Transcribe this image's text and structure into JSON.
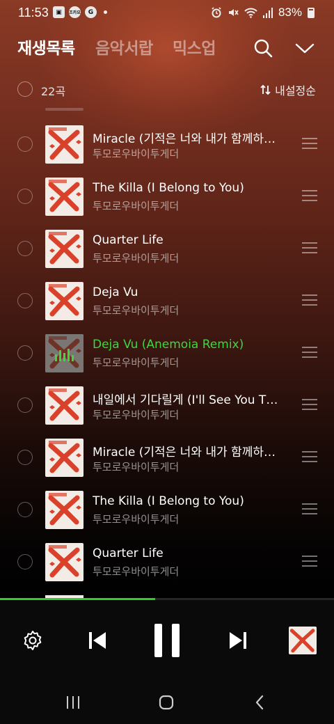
{
  "status_bar": {
    "time": "11:53",
    "left_icons": [
      "gallery-icon",
      "weather-badge-icon",
      "g-badge-icon",
      "dot"
    ],
    "weather_badge": "조카요",
    "g_badge": "G",
    "battery": "83%",
    "right_icons": [
      "alarm-icon",
      "mute-icon",
      "wifi-icon",
      "signal-icon",
      "battery-icon"
    ]
  },
  "header": {
    "tabs": [
      {
        "label": "재생목록",
        "active": true
      },
      {
        "label": "음악서랍",
        "active": false
      },
      {
        "label": "믹스업",
        "active": false
      }
    ]
  },
  "subbar": {
    "count": "22곡",
    "sort_label": "내설정순"
  },
  "playlist": {
    "items": [
      {
        "title": "Miracle (기적은 너와 내가 함께하는 순간마다 일어나고 있어)",
        "artist": "투모로우바이투게더",
        "playing": false
      },
      {
        "title": "The Killa (I Belong to You)",
        "artist": "투모로우바이투게더",
        "playing": false
      },
      {
        "title": "Quarter Life",
        "artist": "투모로우바이투게더",
        "playing": false
      },
      {
        "title": "Deja Vu",
        "artist": "투모로우바이투게더",
        "playing": false
      },
      {
        "title": "Deja Vu (Anemoia Remix)",
        "artist": "투모로우바이투게더",
        "playing": true
      },
      {
        "title": "내일에서 기다릴게 (I'll See You There Tomorrow)",
        "artist": "투모로우바이투게더",
        "playing": false
      },
      {
        "title": "Miracle (기적은 너와 내가 함께하는 순간마다 일어나고 있어)",
        "artist": "투모로우바이투게더",
        "playing": false
      },
      {
        "title": "The Killa (I Belong to You)",
        "artist": "투모로우바이투게더",
        "playing": false
      },
      {
        "title": "Quarter Life",
        "artist": "투모로우바이투게더",
        "playing": false
      }
    ]
  },
  "player": {
    "progress": 0.465,
    "state": "playing"
  },
  "colors": {
    "accent": "#3fd63f",
    "art_background": "#f3ece6",
    "art_motif": "#d9412a"
  }
}
